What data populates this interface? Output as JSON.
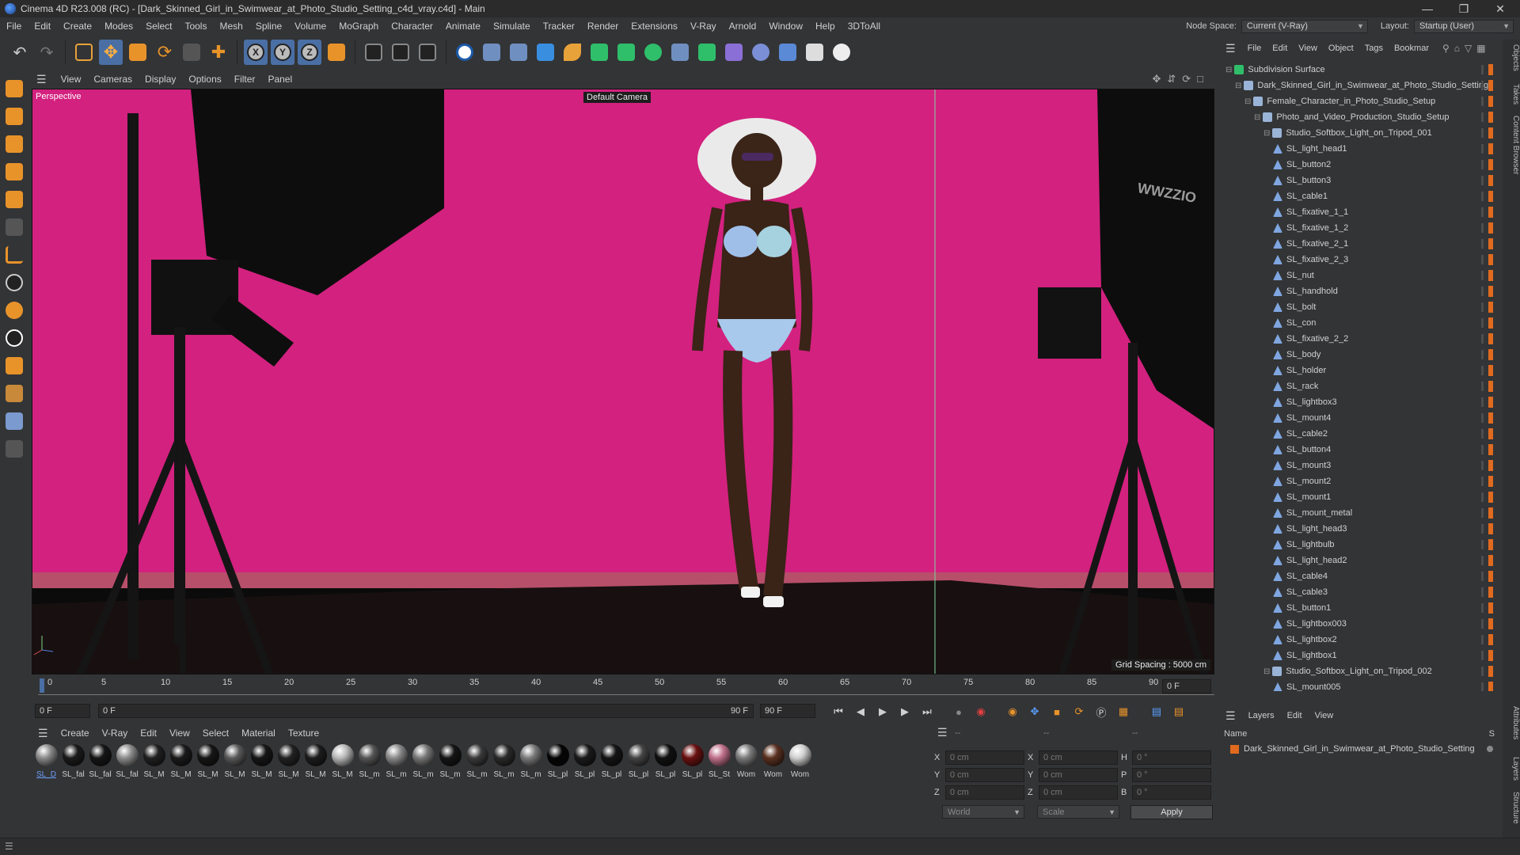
{
  "window": {
    "title": "Cinema 4D R23.008 (RC) - [Dark_Skinned_Girl_in_Swimwear_at_Photo_Studio_Setting_c4d_vray.c4d] - Main"
  },
  "menubar": {
    "items": [
      "File",
      "Edit",
      "Create",
      "Modes",
      "Select",
      "Tools",
      "Mesh",
      "Spline",
      "Volume",
      "MoGraph",
      "Character",
      "Animate",
      "Simulate",
      "Tracker",
      "Render",
      "Extensions",
      "V-Ray",
      "Arnold",
      "Window",
      "Help",
      "3DToAll"
    ],
    "node_space_label": "Node Space:",
    "node_space_value": "Current (V-Ray)",
    "layout_label": "Layout:",
    "layout_value": "Startup (User)"
  },
  "viewport": {
    "menu": [
      "View",
      "Cameras",
      "Display",
      "Options",
      "Filter",
      "Panel"
    ],
    "label": "Perspective",
    "camera": "Default Camera",
    "grid_spacing": "Grid Spacing : 5000 cm"
  },
  "timeline": {
    "ticks": [
      "0",
      "5",
      "10",
      "15",
      "20",
      "25",
      "30",
      "35",
      "40",
      "45",
      "50",
      "55",
      "60",
      "65",
      "70",
      "75",
      "80",
      "85",
      "90"
    ],
    "current_frame": "0 F",
    "start_field": "0 F",
    "range_start": "0 F",
    "range_end": "90 F",
    "end_field": "90 F"
  },
  "materials": {
    "menu": [
      "Create",
      "V-Ray",
      "Edit",
      "View",
      "Select",
      "Material",
      "Texture"
    ],
    "items": [
      {
        "label": "SL_D",
        "color": "#8a8a8a"
      },
      {
        "label": "SL_fal",
        "color": "#1a1a1a"
      },
      {
        "label": "SL_fal",
        "color": "#151515"
      },
      {
        "label": "SL_fal",
        "color": "#8c8c8c"
      },
      {
        "label": "SL_M",
        "color": "#202020"
      },
      {
        "label": "SL_M",
        "color": "#1a1a1a"
      },
      {
        "label": "SL_M",
        "color": "#161616"
      },
      {
        "label": "SL_M",
        "color": "#5a5a5a"
      },
      {
        "label": "SL_M",
        "color": "#161616"
      },
      {
        "label": "SL_M",
        "color": "#222222"
      },
      {
        "label": "SL_M",
        "color": "#1c1c1c"
      },
      {
        "label": "SL_M",
        "color": "#b8b8b8"
      },
      {
        "label": "SL_m",
        "color": "#555555"
      },
      {
        "label": "SL_m",
        "color": "#8a8a8a"
      },
      {
        "label": "SL_m",
        "color": "#777777"
      },
      {
        "label": "SL_m",
        "color": "#141414"
      },
      {
        "label": "SL_m",
        "color": "#3a3a3a"
      },
      {
        "label": "SL_m",
        "color": "#2a2a2a"
      },
      {
        "label": "SL_m",
        "color": "#7a7a7a"
      },
      {
        "label": "SL_pl",
        "color": "#050505"
      },
      {
        "label": "SL_pl",
        "color": "#1a1a1a"
      },
      {
        "label": "SL_pl",
        "color": "#141414"
      },
      {
        "label": "SL_pl",
        "color": "#444444"
      },
      {
        "label": "SL_pl",
        "color": "#101010"
      },
      {
        "label": "SL_pl",
        "color": "#6a1010"
      },
      {
        "label": "SL_St",
        "color": "#c0708a"
      },
      {
        "label": "Wom",
        "color": "#7a7a7a"
      },
      {
        "label": "Wom",
        "color": "#5a3020"
      },
      {
        "label": "Wom",
        "color": "#cfcfcf"
      }
    ]
  },
  "coords": {
    "header_left": "--",
    "header_mid": "--",
    "header_right": "--",
    "rows": [
      {
        "a": "X",
        "av": "0 cm",
        "b": "X",
        "bv": "0 cm",
        "c": "H",
        "cv": "0 °"
      },
      {
        "a": "Y",
        "av": "0 cm",
        "b": "Y",
        "bv": "0 cm",
        "c": "P",
        "cv": "0 °"
      },
      {
        "a": "Z",
        "av": "0 cm",
        "b": "Z",
        "bv": "0 cm",
        "c": "B",
        "cv": "0 °"
      }
    ],
    "world": "World",
    "scale": "Scale",
    "apply": "Apply"
  },
  "object_manager": {
    "menu": [
      "File",
      "Edit",
      "View",
      "Object",
      "Tags",
      "Bookmar"
    ],
    "rows": [
      {
        "label": "Subdivision Surface",
        "indent": 0,
        "type": "subdiv"
      },
      {
        "label": "Dark_Skinned_Girl_in_Swimwear_at_Photo_Studio_Setting",
        "indent": 1,
        "type": "null"
      },
      {
        "label": "Female_Character_in_Photo_Studio_Setup",
        "indent": 2,
        "type": "null"
      },
      {
        "label": "Photo_and_Video_Production_Studio_Setup",
        "indent": 3,
        "type": "null"
      },
      {
        "label": "Studio_Softbox_Light_on_Tripod_001",
        "indent": 4,
        "type": "null"
      },
      {
        "label": "SL_light_head1",
        "indent": 5,
        "type": "poly"
      },
      {
        "label": "SL_button2",
        "indent": 5,
        "type": "poly"
      },
      {
        "label": "SL_button3",
        "indent": 5,
        "type": "poly"
      },
      {
        "label": "SL_cable1",
        "indent": 5,
        "type": "poly"
      },
      {
        "label": "SL_fixative_1_1",
        "indent": 5,
        "type": "poly"
      },
      {
        "label": "SL_fixative_1_2",
        "indent": 5,
        "type": "poly"
      },
      {
        "label": "SL_fixative_2_1",
        "indent": 5,
        "type": "poly"
      },
      {
        "label": "SL_fixative_2_3",
        "indent": 5,
        "type": "poly"
      },
      {
        "label": "SL_nut",
        "indent": 5,
        "type": "poly"
      },
      {
        "label": "SL_handhold",
        "indent": 5,
        "type": "poly"
      },
      {
        "label": "SL_bolt",
        "indent": 5,
        "type": "poly"
      },
      {
        "label": "SL_con",
        "indent": 5,
        "type": "poly"
      },
      {
        "label": "SL_fixative_2_2",
        "indent": 5,
        "type": "poly"
      },
      {
        "label": "SL_body",
        "indent": 5,
        "type": "poly"
      },
      {
        "label": "SL_holder",
        "indent": 5,
        "type": "poly"
      },
      {
        "label": "SL_rack",
        "indent": 5,
        "type": "poly"
      },
      {
        "label": "SL_lightbox3",
        "indent": 5,
        "type": "poly"
      },
      {
        "label": "SL_mount4",
        "indent": 5,
        "type": "poly"
      },
      {
        "label": "SL_cable2",
        "indent": 5,
        "type": "poly"
      },
      {
        "label": "SL_button4",
        "indent": 5,
        "type": "poly"
      },
      {
        "label": "SL_mount3",
        "indent": 5,
        "type": "poly"
      },
      {
        "label": "SL_mount2",
        "indent": 5,
        "type": "poly"
      },
      {
        "label": "SL_mount1",
        "indent": 5,
        "type": "poly"
      },
      {
        "label": "SL_mount_metal",
        "indent": 5,
        "type": "poly"
      },
      {
        "label": "SL_light_head3",
        "indent": 5,
        "type": "poly"
      },
      {
        "label": "SL_lightbulb",
        "indent": 5,
        "type": "poly"
      },
      {
        "label": "SL_light_head2",
        "indent": 5,
        "type": "poly"
      },
      {
        "label": "SL_cable4",
        "indent": 5,
        "type": "poly"
      },
      {
        "label": "SL_cable3",
        "indent": 5,
        "type": "poly"
      },
      {
        "label": "SL_button1",
        "indent": 5,
        "type": "poly"
      },
      {
        "label": "SL_lightbox003",
        "indent": 5,
        "type": "poly"
      },
      {
        "label": "SL_lightbox2",
        "indent": 5,
        "type": "poly"
      },
      {
        "label": "SL_lightbox1",
        "indent": 5,
        "type": "poly"
      },
      {
        "label": "Studio_Softbox_Light_on_Tripod_002",
        "indent": 4,
        "type": "null"
      },
      {
        "label": "SL_mount005",
        "indent": 5,
        "type": "poly"
      }
    ]
  },
  "right_tabs": [
    "Objects",
    "Takes",
    "Content Browser",
    "Attributes",
    "Layers",
    "Structure"
  ],
  "layers": {
    "menu": [
      "Layers",
      "Edit",
      "View"
    ],
    "col_name": "Name",
    "col_s": "S",
    "row": "Dark_Skinned_Girl_in_Swimwear_at_Photo_Studio_Setting"
  },
  "colors": {
    "accent": "#4a6fa5",
    "background_wall": "#d1247e",
    "layer_swatch": "#e06a1e"
  }
}
